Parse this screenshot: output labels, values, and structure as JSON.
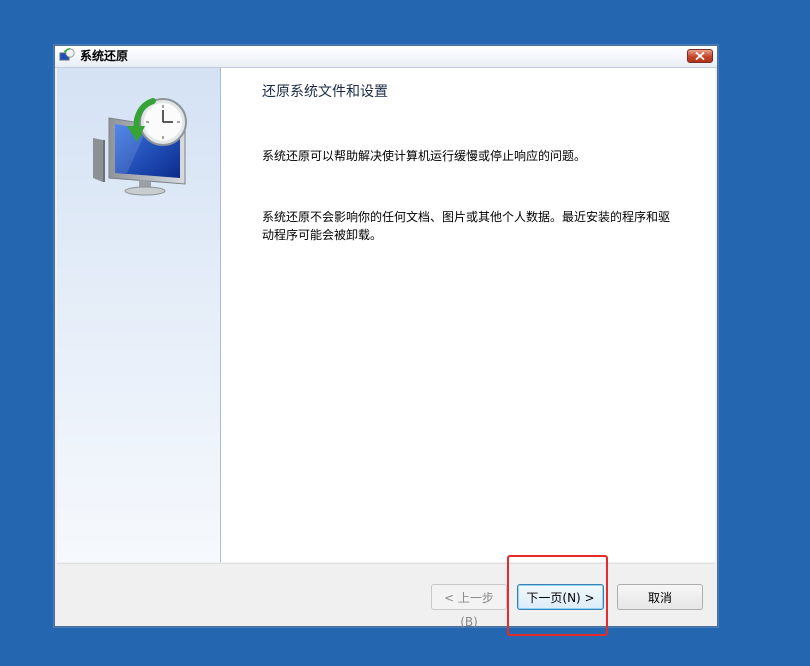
{
  "window": {
    "title": "系统还原",
    "title_icon": "system-restore-icon",
    "close_icon": "close-icon"
  },
  "content": {
    "heading": "还原系统文件和设置",
    "paragraph1": "系统还原可以帮助解决使计算机运行缓慢或停止响应的问题。",
    "paragraph2": "系统还原不会影响你的任何文档、图片或其他个人数据。最近安装的程序和驱动程序可能会被卸载。"
  },
  "buttons": {
    "back": "< 上一步(B)",
    "next": "下一页(N) >",
    "cancel": "取消"
  },
  "colors": {
    "desktop": "#2566b0",
    "highlight": "#e62b2b"
  }
}
